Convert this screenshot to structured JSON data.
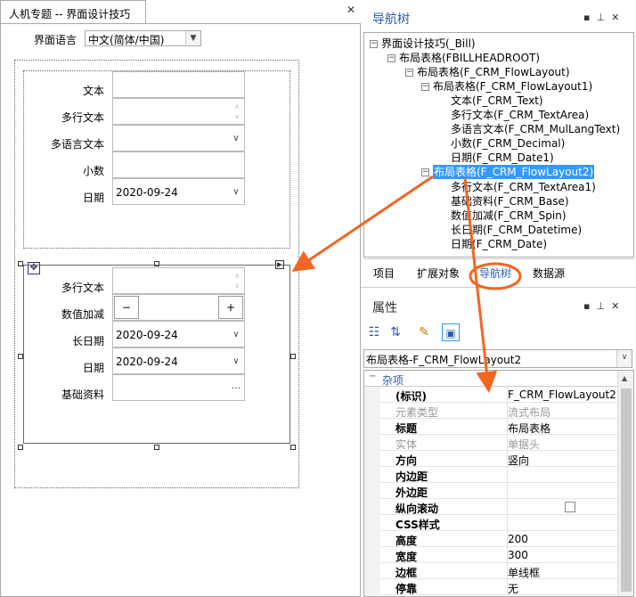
{
  "document": {
    "tab_title": "人机专题 -- 界面设计技巧",
    "language_label": "界面语言",
    "language_value": "中文(简体/中国)",
    "layout1_fields": [
      {
        "label": "文本",
        "value": ""
      },
      {
        "label": "多行文本",
        "value": ""
      },
      {
        "label": "多语言文本",
        "value": ""
      },
      {
        "label": "小数",
        "value": ""
      },
      {
        "label": "日期",
        "value": "2020-09-24"
      }
    ],
    "layout2_fields": [
      {
        "label": "多行文本",
        "value": ""
      },
      {
        "label": "数值加减",
        "value": ""
      },
      {
        "label": "长日期",
        "value": "2020-09-24"
      },
      {
        "label": "日期",
        "value": "2020-09-24"
      },
      {
        "label": "基础资料",
        "value": ""
      }
    ],
    "spin_minus": "−",
    "spin_plus": "+",
    "lookup_button": "···"
  },
  "navigator": {
    "title": "导航树",
    "tree": [
      {
        "label": "界面设计技巧(_Bill)",
        "toggle": "−"
      },
      {
        "label": "布局表格(FBILLHEADROOT)",
        "toggle": "−"
      },
      {
        "label": "布局表格(F_CRM_FlowLayout)",
        "toggle": "−"
      },
      {
        "label": "布局表格(F_CRM_FlowLayout1)",
        "toggle": "−"
      },
      {
        "label": "文本(F_CRM_Text)"
      },
      {
        "label": "多行文本(F_CRM_TextArea)"
      },
      {
        "label": "多语言文本(F_CRM_MulLangText)"
      },
      {
        "label": "小数(F_CRM_Decimal)"
      },
      {
        "label": "日期(F_CRM_Date1)"
      },
      {
        "label": "布局表格(F_CRM_FlowLayout2)",
        "toggle": "−",
        "selected": true
      },
      {
        "label": "多行文本(F_CRM_TextArea1)"
      },
      {
        "label": "基础资料(F_CRM_Base)"
      },
      {
        "label": "数值加减(F_CRM_Spin)"
      },
      {
        "label": "长日期(F_CRM_Datetime)"
      },
      {
        "label": "日期(F_CRM_Date)"
      }
    ],
    "tabs": [
      "项目",
      "扩展对象",
      "导航树",
      "数据源"
    ],
    "active_tab": "导航树"
  },
  "properties": {
    "title": "属性",
    "selected_object": "布局表格-F_CRM_FlowLayout2",
    "category": "杂项",
    "rows": [
      {
        "name": "(标识)",
        "value": "F_CRM_FlowLayout2"
      },
      {
        "name": "元素类型",
        "value": "流式布局",
        "dim": true
      },
      {
        "name": "标题",
        "value": "布局表格"
      },
      {
        "name": "实体",
        "value": "单据头",
        "dim": true
      },
      {
        "name": "方向",
        "value": "竖向"
      },
      {
        "name": "内边距",
        "value": ""
      },
      {
        "name": "外边距",
        "value": ""
      },
      {
        "name": "纵向滚动",
        "value": "",
        "checkbox": true
      },
      {
        "name": "CSS样式",
        "value": ""
      },
      {
        "name": "高度",
        "value": "200"
      },
      {
        "name": "宽度",
        "value": "300"
      },
      {
        "name": "边框",
        "value": "单线框"
      },
      {
        "name": "停靠",
        "value": "无"
      }
    ]
  },
  "colors": {
    "accent": "#2a5db0",
    "selection": "#3399ff",
    "annotation": "#f26522"
  },
  "icons": [
    "close-icon",
    "pin-icon",
    "dropdown-icon",
    "move-handle-icon",
    "expand-icon",
    "categorized-icon",
    "sort-icon",
    "edit-icon",
    "page-icon"
  ]
}
